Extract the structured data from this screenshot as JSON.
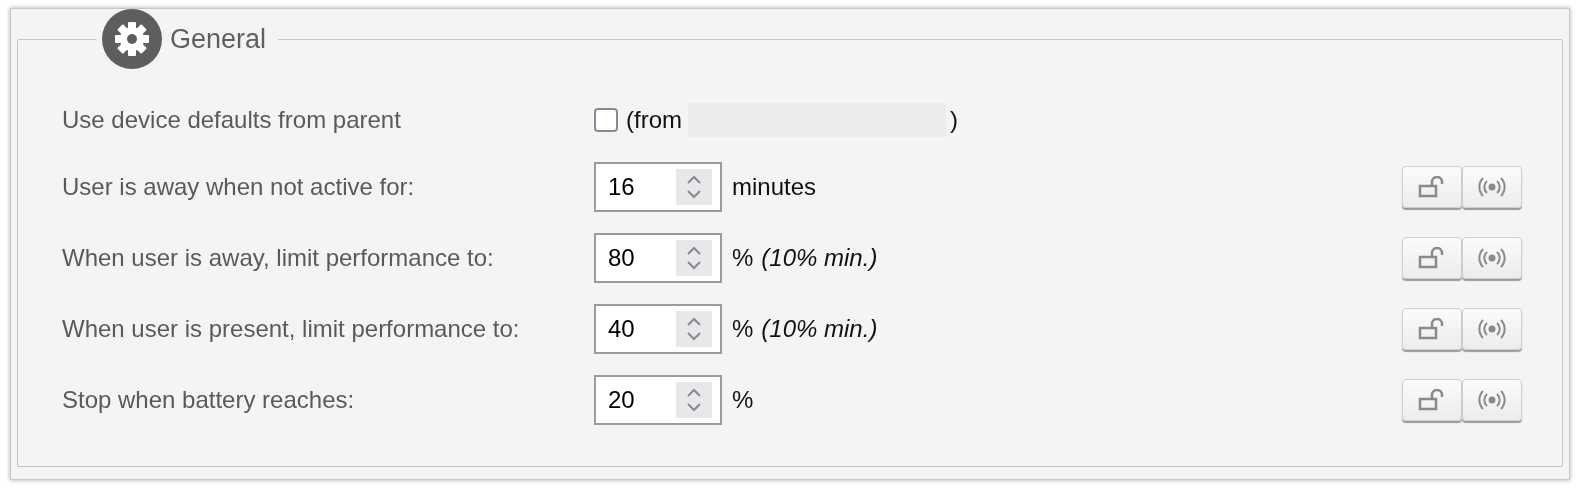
{
  "section": {
    "title": "General"
  },
  "rows": [
    {
      "kind": "checkbox",
      "label": "Use device defaults from parent",
      "checked": false,
      "prefix": "(from",
      "suffix": ")"
    },
    {
      "kind": "spinner",
      "label": "User is away when not active for:",
      "value": "16",
      "unit": "minutes"
    },
    {
      "kind": "spinner",
      "label": "When user is away, limit performance to:",
      "value": "80",
      "unit": "%",
      "note": "(10% min.)"
    },
    {
      "kind": "spinner",
      "label": "When user is present, limit performance to:",
      "value": "40",
      "unit": "%",
      "note": "(10% min.)"
    },
    {
      "kind": "spinner",
      "label": "Stop when battery reaches:",
      "value": "20",
      "unit": "%"
    }
  ]
}
